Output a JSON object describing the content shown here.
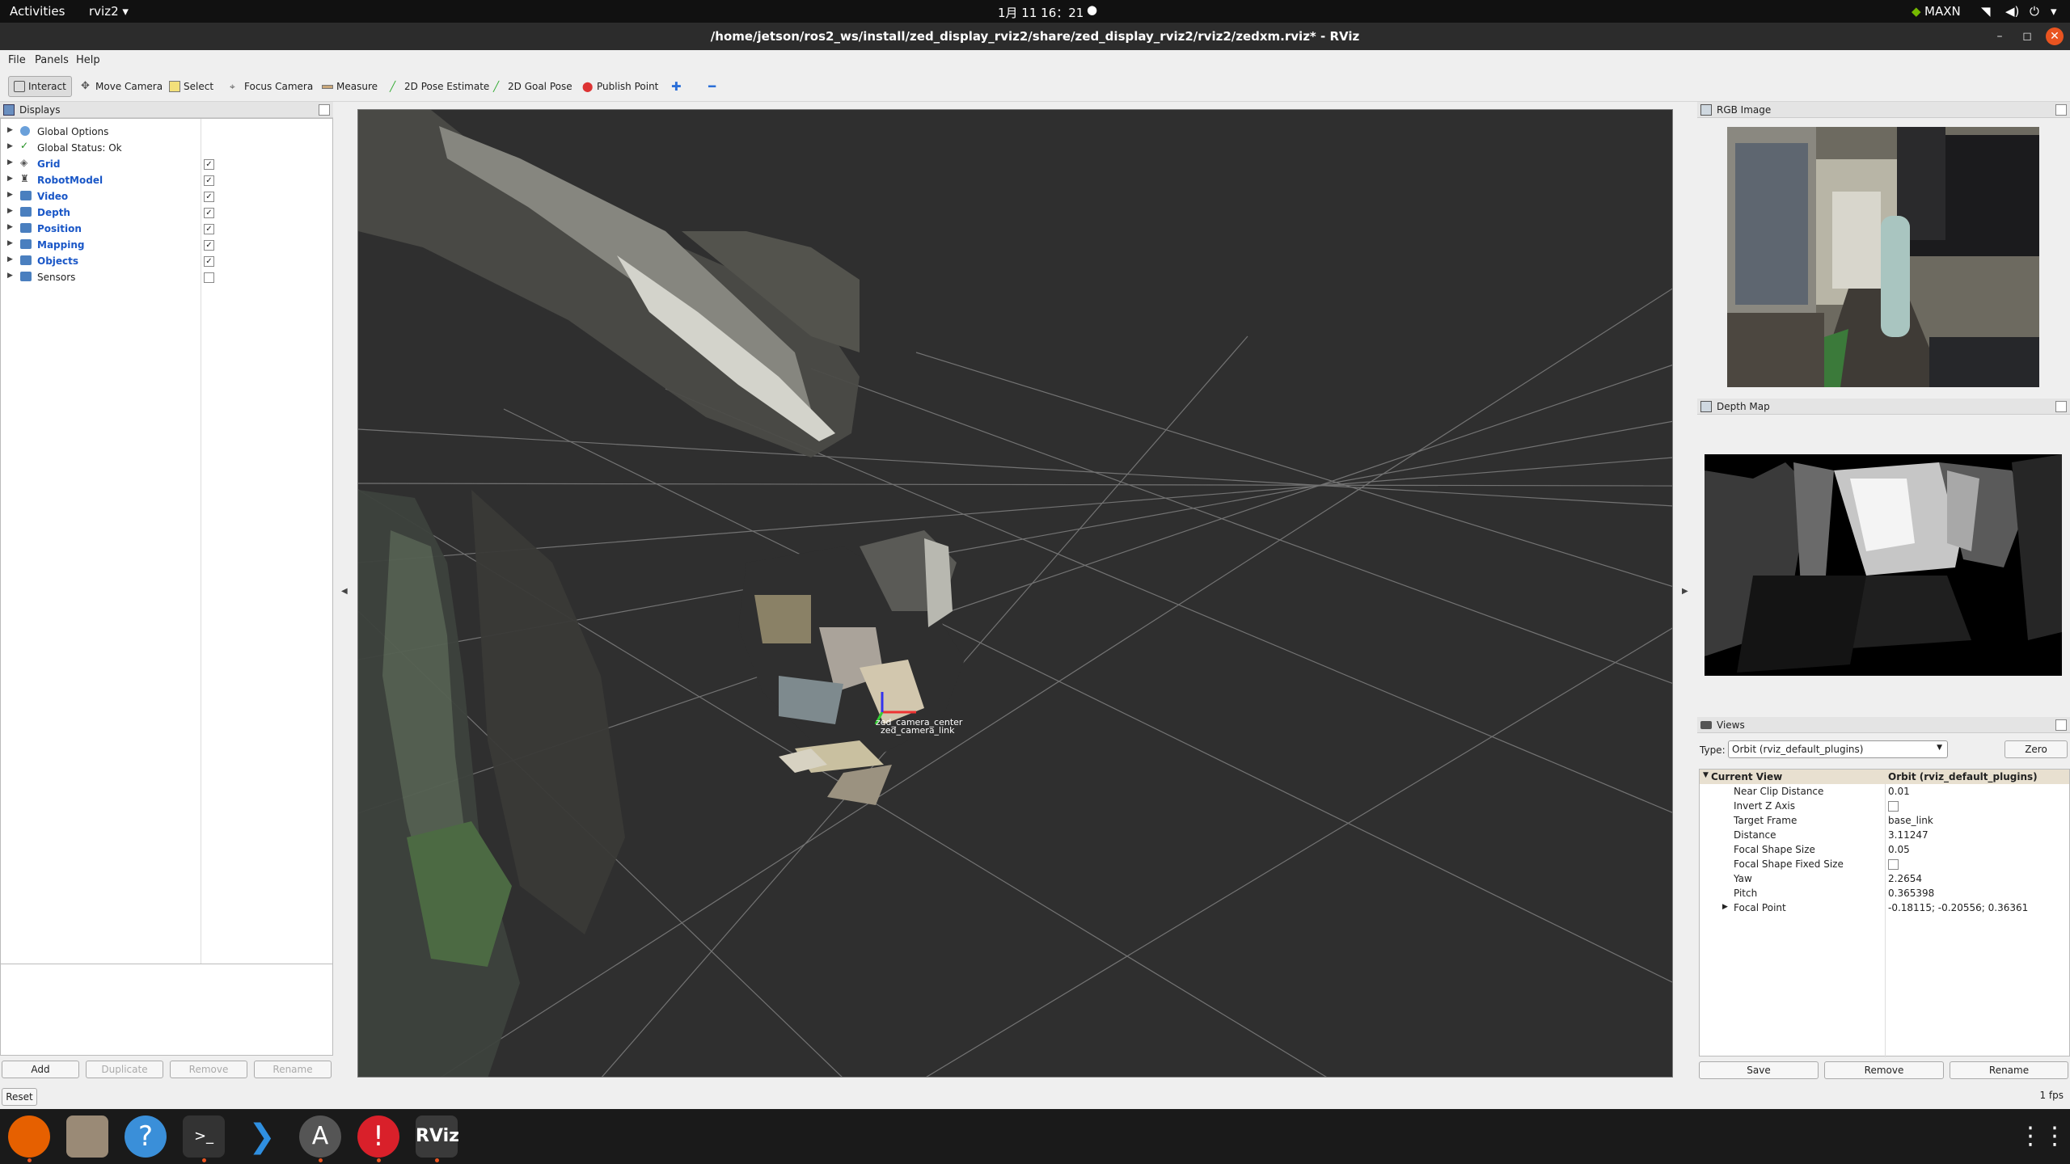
{
  "topbar": {
    "activities": "Activities",
    "app": "rviz2",
    "clock": "1月 11  16：21",
    "power_mode": "MAXN"
  },
  "window": {
    "title": "/home/jetson/ros2_ws/install/zed_display_rviz2/share/zed_display_rviz2/rviz2/zedxm.rviz* - RViz"
  },
  "menu": [
    "File",
    "Panels",
    "Help"
  ],
  "toolbar": [
    "Interact",
    "Move Camera",
    "Select",
    "Focus Camera",
    "Measure",
    "2D Pose Estimate",
    "2D Goal Pose",
    "Publish Point"
  ],
  "displays": {
    "title": "Displays",
    "items": [
      {
        "label": "Global Options",
        "checked": null
      },
      {
        "label": "Global Status: Ok",
        "checked": null
      },
      {
        "label": "Grid",
        "checked": true
      },
      {
        "label": "RobotModel",
        "checked": true
      },
      {
        "label": "Video",
        "checked": true
      },
      {
        "label": "Depth",
        "checked": true
      },
      {
        "label": "Position",
        "checked": true
      },
      {
        "label": "Mapping",
        "checked": true
      },
      {
        "label": "Objects",
        "checked": true
      },
      {
        "label": "Sensors",
        "checked": false
      }
    ],
    "buttons": {
      "add": "Add",
      "duplicate": "Duplicate",
      "remove": "Remove",
      "rename": "Rename"
    },
    "reset": "Reset"
  },
  "viewport": {
    "frame_label_1": "zed_camera_center",
    "frame_label_2": "zed_camera_link"
  },
  "rgb_panel": {
    "title": "RGB Image"
  },
  "depth_panel": {
    "title": "Depth Map"
  },
  "views": {
    "title": "Views",
    "type_label": "Type:",
    "type_value": "Orbit (rviz_default_plugins)",
    "zero": "Zero",
    "current_view": "Current View",
    "current_view_value": "Orbit (rviz_default_plugins)",
    "props": [
      {
        "key": "Near Clip Distance",
        "value": "0.01"
      },
      {
        "key": "Invert Z Axis",
        "value": ""
      },
      {
        "key": "Target Frame",
        "value": "base_link"
      },
      {
        "key": "Distance",
        "value": "3.11247"
      },
      {
        "key": "Focal Shape Size",
        "value": "0.05"
      },
      {
        "key": "Focal Shape Fixed Size",
        "value": ""
      },
      {
        "key": "Yaw",
        "value": "2.2654"
      },
      {
        "key": "Pitch",
        "value": "0.365398"
      },
      {
        "key": "Focal Point",
        "value": "-0.18115; -0.20556; 0.36361"
      }
    ],
    "buttons": {
      "save": "Save",
      "remove": "Remove",
      "rename": "Rename"
    }
  },
  "status": {
    "fps": "1 fps"
  },
  "colors": {
    "topbar": "#111111",
    "titlebar": "#2c2c2c",
    "viewport_bg": "#2f2f2f",
    "link_blue": "#1a57c7",
    "close_btn": "#e95420"
  }
}
